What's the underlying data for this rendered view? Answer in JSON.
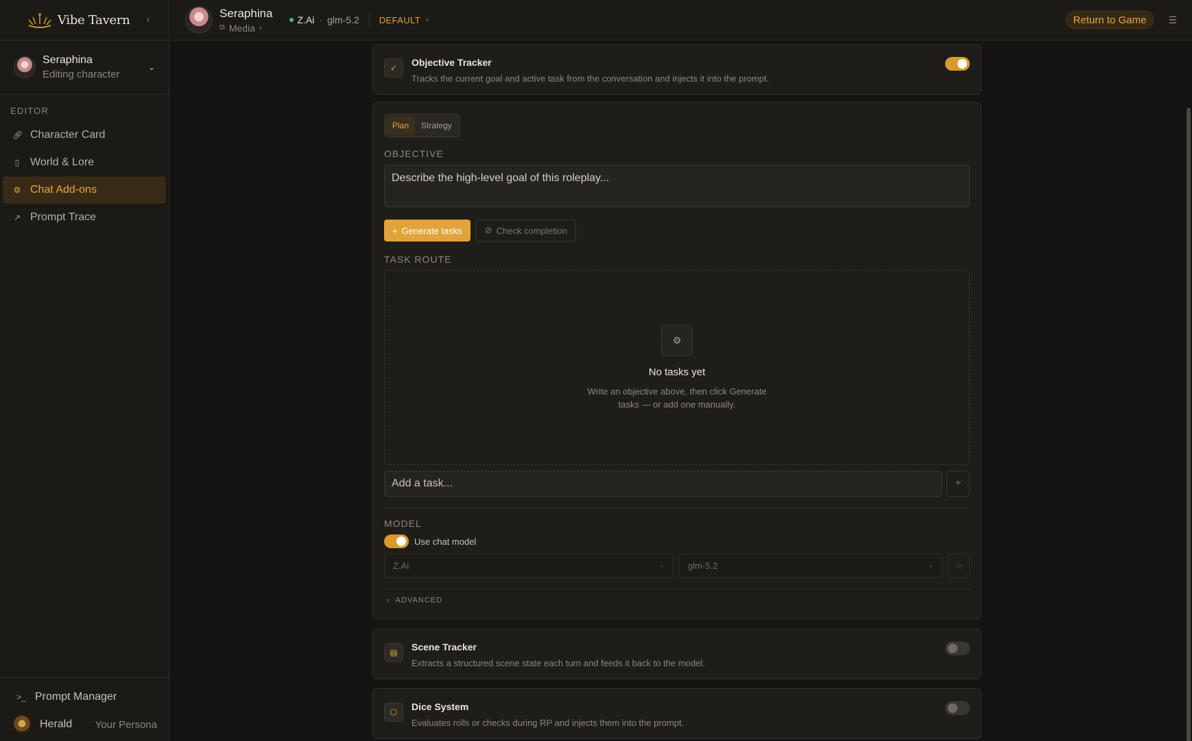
{
  "brand": {
    "name": "Vibe Tavern"
  },
  "character": {
    "name": "Seraphina",
    "subtitle": "Editing character"
  },
  "sidebar": {
    "section_label": "EDITOR",
    "items": [
      {
        "label": "Character Card",
        "icon": "link-icon"
      },
      {
        "label": "World & Lore",
        "icon": "book-icon"
      },
      {
        "label": "Chat Add-ons",
        "icon": "gear-icon"
      },
      {
        "label": "Prompt Trace",
        "icon": "trend-icon"
      }
    ],
    "prompt_manager": "Prompt Manager",
    "persona": {
      "name": "Herald",
      "role": "Your Persona"
    }
  },
  "topbar": {
    "char_name": "Seraphina",
    "media": "Media",
    "provider": "Z.Ai",
    "model": "glm-5.2",
    "preset": "DEFAULT",
    "return_label": "Return to Game"
  },
  "objective_tracker": {
    "title": "Objective Tracker",
    "desc": "Tracks the current goal and active task from the conversation and injects it into the prompt.",
    "enabled": true,
    "tabs": [
      "Plan",
      "Strategy"
    ],
    "objective_label": "OBJECTIVE",
    "objective_placeholder": "Describe the high-level goal of this roleplay...",
    "generate_label": "Generate tasks",
    "check_label": "Check completion",
    "task_route_label": "TASK ROUTE",
    "empty_title": "No tasks yet",
    "empty_desc": "Write an objective above, then click Generate tasks — or add one manually.",
    "add_task_placeholder": "Add a task...",
    "model_label": "MODEL",
    "use_chat_model_label": "Use chat model",
    "use_chat_model": true,
    "provider_select": "Z.Ai",
    "model_select": "glm-5.2",
    "advanced_label": "ADVANCED"
  },
  "scene_tracker": {
    "title": "Scene Tracker",
    "desc": "Extracts a structured scene state each turn and feeds it back to the model.",
    "enabled": false
  },
  "dice_system": {
    "title": "Dice System",
    "desc": "Evaluates rolls or checks during RP and injects them into the prompt.",
    "enabled": false
  }
}
